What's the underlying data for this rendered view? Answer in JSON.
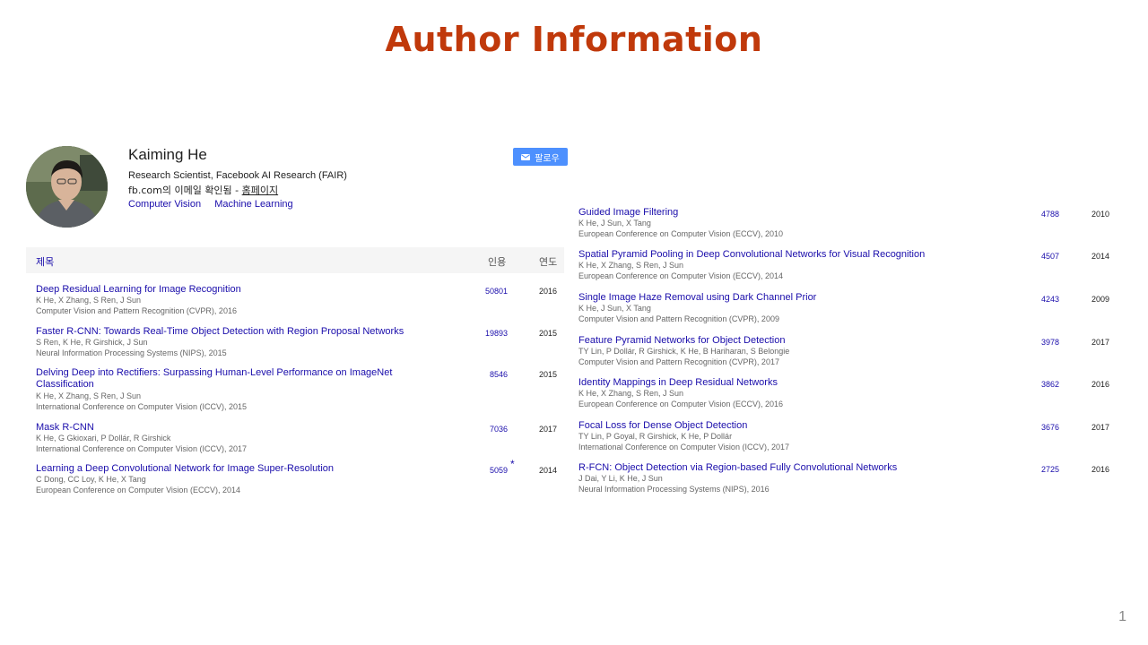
{
  "slide": {
    "title": "Author Information",
    "page_number": "1"
  },
  "profile": {
    "name": "Kaiming He",
    "affiliation": "Research Scientist, Facebook AI Research (FAIR)",
    "email_text": "fb.com의 이메일 확인됨 - ",
    "homepage_label": "홈페이지",
    "interests": [
      "Computer Vision",
      "Machine Learning"
    ],
    "follow_label": "팔로우"
  },
  "table": {
    "col_title": "제목",
    "col_cited": "인용",
    "col_year": "연도"
  },
  "left_papers": [
    {
      "title": "Deep Residual Learning for Image Recognition",
      "authors": "K He, X Zhang, S Ren, J Sun",
      "venue": "Computer Vision and Pattern Recognition (CVPR), 2016",
      "cites": "50801",
      "year": "2016"
    },
    {
      "title": "Faster R-CNN: Towards Real-Time Object Detection with Region Proposal Networks",
      "authors": "S Ren, K He, R Girshick, J Sun",
      "venue": "Neural Information Processing Systems (NIPS), 2015",
      "cites": "19893",
      "year": "2015"
    },
    {
      "title": "Delving Deep into Rectifiers: Surpassing Human-Level Performance on ImageNet Classification",
      "authors": "K He, X Zhang, S Ren, J Sun",
      "venue": "International Conference on Computer Vision (ICCV), 2015",
      "cites": "8546",
      "year": "2015"
    },
    {
      "title": "Mask R-CNN",
      "authors": "K He, G Gkioxari, P Dollár, R Girshick",
      "venue": "International Conference on Computer Vision (ICCV), 2017",
      "cites": "7036",
      "year": "2017"
    },
    {
      "title": "Learning a Deep Convolutional Network for Image Super-Resolution",
      "authors": "C Dong, CC Loy, K He, X Tang",
      "venue": "European Conference on Computer Vision (ECCV), 2014",
      "cites": "5059",
      "year": "2014",
      "star": "*"
    }
  ],
  "right_papers": [
    {
      "title": "Guided Image Filtering",
      "authors": "K He, J Sun, X Tang",
      "venue": "European Conference on Computer Vision (ECCV), 2010",
      "cites": "4788",
      "year": "2010"
    },
    {
      "title": "Spatial Pyramid Pooling in Deep Convolutional Networks for Visual Recognition",
      "authors": "K He, X Zhang, S Ren, J Sun",
      "venue": "European Conference on Computer Vision (ECCV), 2014",
      "cites": "4507",
      "year": "2014"
    },
    {
      "title": "Single Image Haze Removal using Dark Channel Prior",
      "authors": "K He, J Sun, X Tang",
      "venue": "Computer Vision and Pattern Recognition (CVPR), 2009",
      "cites": "4243",
      "year": "2009"
    },
    {
      "title": "Feature Pyramid Networks for Object Detection",
      "authors": "TY Lin, P Dollár, R Girshick, K He, B Hariharan, S Belongie",
      "venue": "Computer Vision and Pattern Recognition (CVPR), 2017",
      "cites": "3978",
      "year": "2017"
    },
    {
      "title": "Identity Mappings in Deep Residual Networks",
      "authors": "K He, X Zhang, S Ren, J Sun",
      "venue": "European Conference on Computer Vision (ECCV), 2016",
      "cites": "3862",
      "year": "2016"
    },
    {
      "title": "Focal Loss for Dense Object Detection",
      "authors": "TY Lin, P Goyal, R Girshick, K He, P Dollár",
      "venue": "International Conference on Computer Vision (ICCV), 2017",
      "cites": "3676",
      "year": "2017"
    },
    {
      "title": "R-FCN: Object Detection via Region-based Fully Convolutional Networks",
      "authors": "J Dai, Y Li, K He, J Sun",
      "venue": "Neural Information Processing Systems (NIPS), 2016",
      "cites": "2725",
      "year": "2016"
    }
  ],
  "colors": {
    "title": "#c0390b",
    "link": "#1a0dab",
    "follow_button": "#4d90fe"
  },
  "icons": {
    "follow": "mail-icon",
    "avatar": "author-photo"
  }
}
